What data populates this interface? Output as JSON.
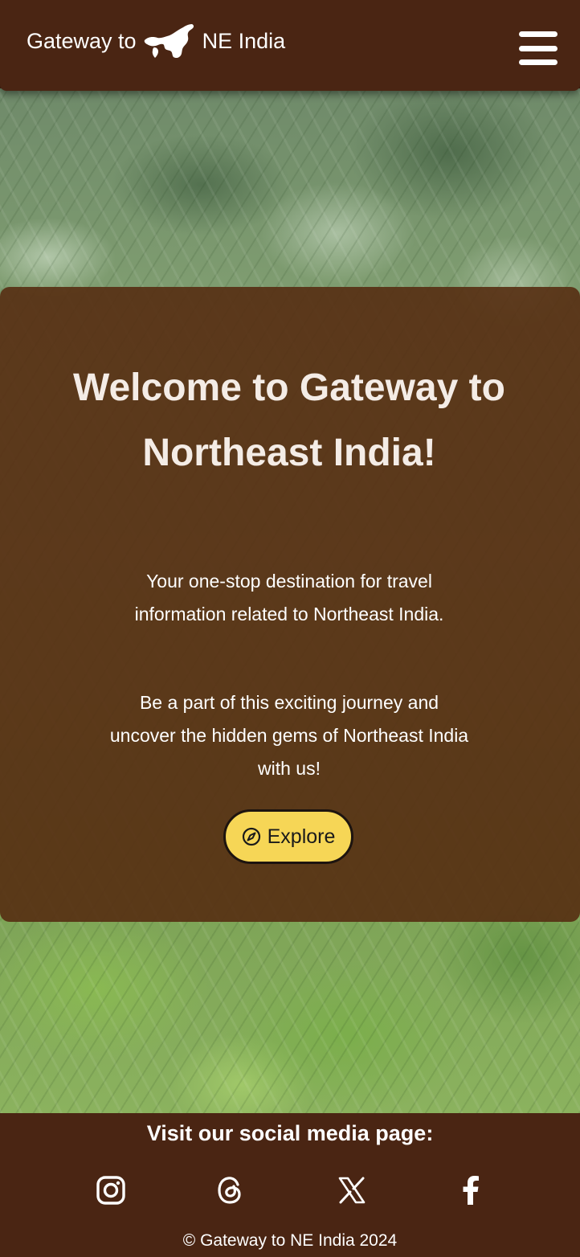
{
  "header": {
    "brand_prefix": "Gateway to",
    "brand_suffix": "NE India",
    "menu_icon": "hamburger-menu-icon",
    "logo_icon": "northeast-india-map-icon"
  },
  "welcome": {
    "title": "Welcome to Gateway to Northeast India!",
    "description": "Your one-stop destination for travel information related to Northeast India.",
    "call_to_action": "Be a part of this exciting journey and uncover the hidden gems of Northeast India with us!",
    "explore_label": "Explore",
    "explore_icon": "compass-icon"
  },
  "footer": {
    "social_heading": "Visit our social media page:",
    "social_links": [
      {
        "name": "Instagram",
        "icon": "instagram-icon"
      },
      {
        "name": "Threads",
        "icon": "threads-icon"
      },
      {
        "name": "X",
        "icon": "x-icon"
      },
      {
        "name": "Facebook",
        "icon": "facebook-icon"
      }
    ],
    "copyright": "© Gateway to NE India 2024"
  },
  "colors": {
    "brown_bar": "#4a2513",
    "card_overlay": "#562d12",
    "explore_yellow": "#f6d656",
    "text_light": "#f4ece6"
  }
}
